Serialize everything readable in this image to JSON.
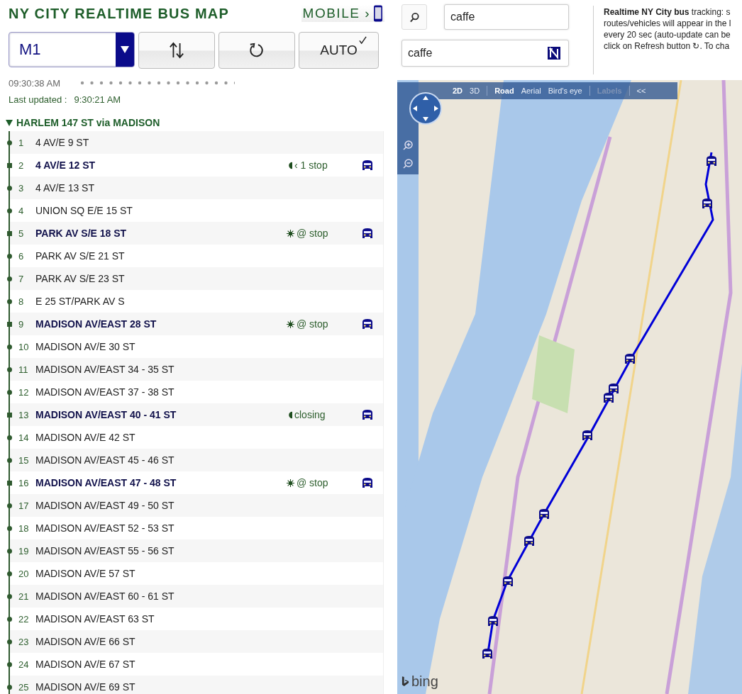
{
  "header": {
    "title": "NY CITY REALTIME BUS MAP",
    "mobile_link": "MOBILE ›"
  },
  "controls": {
    "route": "M1",
    "auto": {
      "label": "AUTO",
      "checked": true
    }
  },
  "clock": "09:30:38 AM",
  "last_updated": {
    "label": "Last updated :",
    "time": "9:30:21 AM"
  },
  "direction": {
    "title": "HARLEM 147 ST via MADISON",
    "expanded": true
  },
  "stops": [
    {
      "number": "1",
      "name": "4 AV/E 9 ST",
      "bus": false
    },
    {
      "number": "2",
      "name": "4 AV/E 12 ST",
      "bus": true,
      "status": {
        "kind": "approaching",
        "text": "‹ 1 stop"
      }
    },
    {
      "number": "3",
      "name": "4 AV/E 13 ST",
      "bus": false
    },
    {
      "number": "4",
      "name": "UNION SQ E/E 15 ST",
      "bus": false
    },
    {
      "number": "5",
      "name": "PARK AV S/E 18 ST",
      "bus": true,
      "status": {
        "kind": "at_stop",
        "text": "@ stop"
      }
    },
    {
      "number": "6",
      "name": "PARK AV S/E 21 ST",
      "bus": false
    },
    {
      "number": "7",
      "name": "PARK AV S/E 23 ST",
      "bus": false
    },
    {
      "number": "8",
      "name": "E 25 ST/PARK AV S",
      "bus": false
    },
    {
      "number": "9",
      "name": "MADISON AV/EAST 28 ST",
      "bus": true,
      "status": {
        "kind": "at_stop",
        "text": "@ stop"
      }
    },
    {
      "number": "10",
      "name": "MADISON AV/E 30 ST",
      "bus": false
    },
    {
      "number": "11",
      "name": "MADISON AV/EAST 34 - 35 ST",
      "bus": false
    },
    {
      "number": "12",
      "name": "MADISON AV/EAST 37 - 38 ST",
      "bus": false
    },
    {
      "number": "13",
      "name": "MADISON AV/EAST 40 - 41 ST",
      "bus": true,
      "status": {
        "kind": "closing",
        "text": "closing"
      }
    },
    {
      "number": "14",
      "name": "MADISON AV/E 42 ST",
      "bus": false
    },
    {
      "number": "15",
      "name": "MADISON AV/EAST 45 - 46 ST",
      "bus": false
    },
    {
      "number": "16",
      "name": "MADISON AV/EAST 47 - 48 ST",
      "bus": true,
      "status": {
        "kind": "at_stop",
        "text": "@ stop"
      }
    },
    {
      "number": "17",
      "name": "MADISON AV/EAST 49 - 50 ST",
      "bus": false
    },
    {
      "number": "18",
      "name": "MADISON AV/EAST 52 - 53 ST",
      "bus": false
    },
    {
      "number": "19",
      "name": "MADISON AV/EAST 55 - 56 ST",
      "bus": false
    },
    {
      "number": "20",
      "name": "MADISON AV/E 57 ST",
      "bus": false
    },
    {
      "number": "21",
      "name": "MADISON AV/EAST 60 - 61 ST",
      "bus": false
    },
    {
      "number": "22",
      "name": "MADISON AV/EAST 63 ST",
      "bus": false
    },
    {
      "number": "23",
      "name": "MADISON AV/E 66 ST",
      "bus": false
    },
    {
      "number": "24",
      "name": "MADISON AV/E 67 ST",
      "bus": false
    },
    {
      "number": "25",
      "name": "MADISON AV/E 69 ST",
      "bus": false
    }
  ],
  "search": {
    "query": "caffe",
    "place": "caffe"
  },
  "info_lines": [
    "**Realtime NY City bus** tracking: s",
    "routes/vehicles will appear in the l",
    "every 20 sec (auto-update can be",
    "click on Refresh button ↻. To cha"
  ],
  "map": {
    "modes": [
      {
        "label": "2D",
        "selected": true
      },
      {
        "label": "3D",
        "selected": false
      }
    ],
    "views": [
      {
        "label": "Road",
        "selected": true
      },
      {
        "label": "Aerial",
        "selected": false
      },
      {
        "label": "Bird's eye",
        "selected": false
      }
    ],
    "labels": {
      "label": "Labels",
      "disabled": true
    },
    "collapse": "<<",
    "attribution": "bing"
  }
}
